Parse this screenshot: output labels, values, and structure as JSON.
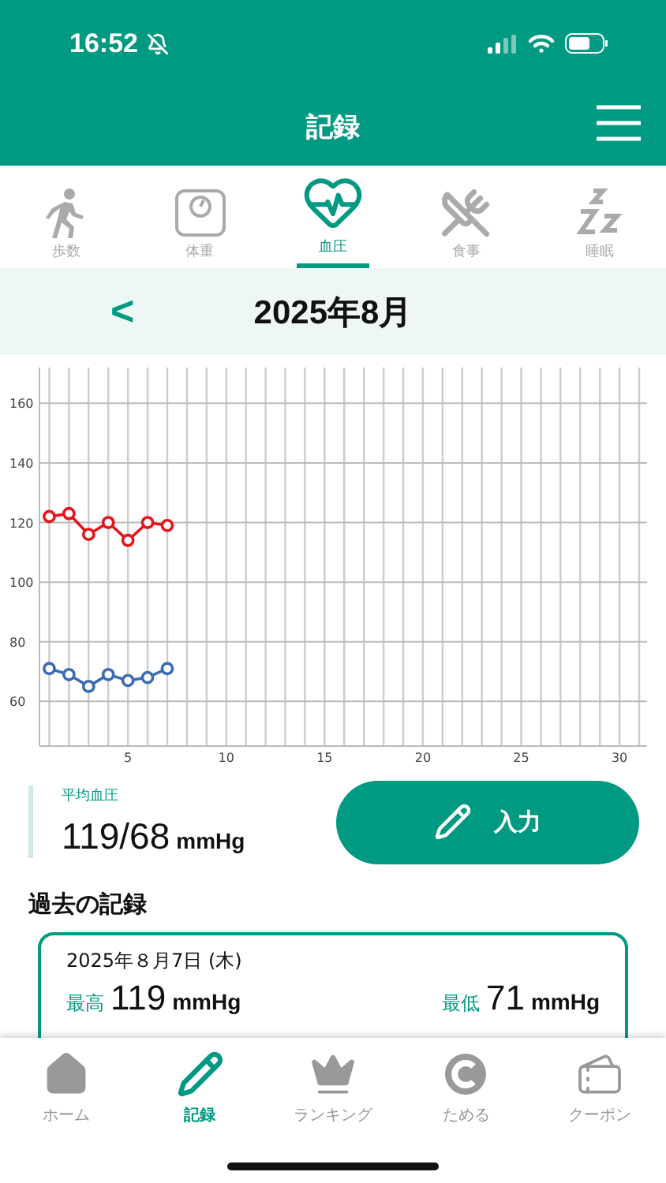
{
  "status_bar": {
    "time": "16:52"
  },
  "header": {
    "title": "記録"
  },
  "category_tabs": [
    {
      "kind": "steps",
      "label": "歩数",
      "selected": false
    },
    {
      "kind": "weight",
      "label": "体重",
      "selected": false
    },
    {
      "kind": "pressure",
      "label": "血圧",
      "selected": true
    },
    {
      "kind": "meal",
      "label": "食事",
      "selected": false
    },
    {
      "kind": "sleep",
      "label": "睡眠",
      "selected": false
    }
  ],
  "month_bar": {
    "prev": "<",
    "month": "2025年8月"
  },
  "chart_data": {
    "type": "line",
    "x": [
      1,
      2,
      3,
      4,
      5,
      6,
      7
    ],
    "xlim": [
      0.5,
      31.4
    ],
    "ylim": [
      45,
      172
    ],
    "xticks": [
      5,
      10,
      15,
      20,
      25,
      30
    ],
    "yticks": [
      60,
      80,
      100,
      120,
      140,
      160
    ],
    "grid": true,
    "series": [
      {
        "color": "#e8141c",
        "marker": "circle",
        "values": [
          122,
          123,
          116,
          120,
          114,
          120,
          119
        ]
      },
      {
        "color": "#3a6cb5",
        "marker": "circle",
        "values": [
          71,
          69,
          65,
          69,
          67,
          68,
          71
        ]
      }
    ]
  },
  "summary": {
    "label": "平均血圧",
    "value": "119/68",
    "unit": "mmHg"
  },
  "input_button": {
    "label": "入力"
  },
  "history": {
    "title": "過去の記録",
    "records": [
      {
        "date": "2025年８月7日 (木)",
        "high_label": "最高",
        "high": "119",
        "high_unit": "mmHg",
        "low_label": "最低",
        "low": "71",
        "low_unit": "mmHg"
      }
    ]
  },
  "bottom_nav": [
    {
      "kind": "home",
      "label": "ホーム",
      "selected": false
    },
    {
      "kind": "record",
      "label": "記録",
      "selected": true
    },
    {
      "kind": "ranking",
      "label": "ランキング",
      "selected": false
    },
    {
      "kind": "coin",
      "label": "ためる",
      "selected": false
    },
    {
      "kind": "coupon",
      "label": "クーポン",
      "selected": false
    }
  ]
}
